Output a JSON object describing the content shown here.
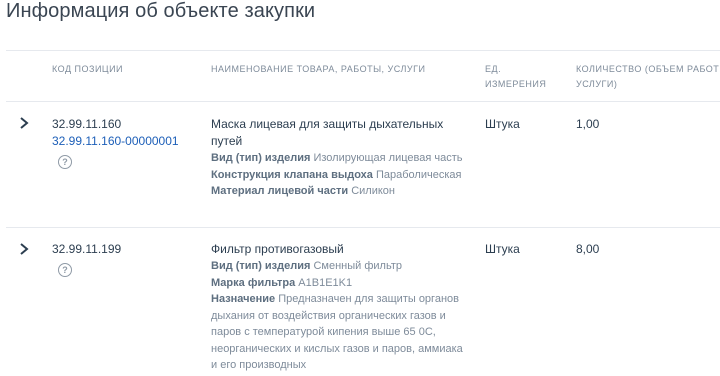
{
  "title": "Информация об объекте закупки",
  "columns": {
    "code": "КОД ПОЗИЦИИ",
    "name": "НАИМЕНОВАНИЕ ТОВАРА, РАБОТЫ, УСЛУГИ",
    "unit_line1": "ЕД.",
    "unit_line2": "ИЗМЕРЕНИЯ",
    "qty_line1": "КОЛИЧЕСТВО (ОБЪЕМ РАБОТЫ,",
    "qty_line2": "УСЛУГИ)"
  },
  "rows": [
    {
      "code": "32.99.11.160",
      "code_link": "32.99.11.160-00000001",
      "help_icon": "question-circle-icon",
      "name_line1": "Маска лицевая для защиты дыхательных",
      "name_line2": "путей",
      "attrs": [
        {
          "label": "Вид (тип) изделия",
          "value": "Изолирующая лицевая часть"
        },
        {
          "label": "Конструкция клапана выдоха",
          "value": "Параболическая"
        },
        {
          "label": "Материал лицевой части",
          "value": "Силикон"
        }
      ],
      "unit": "Штука",
      "qty": "1,00"
    },
    {
      "code": "32.99.11.199",
      "help_icon": "question-circle-icon",
      "name_line1": "Фильтр противогазовый",
      "attrs": [
        {
          "label": "Вид (тип) изделия",
          "value": "Сменный фильтр"
        },
        {
          "label": "Марка фильтра",
          "value": "A1B1E1K1"
        },
        {
          "label": "Назначение",
          "value": "Предназначен для защиты органов"
        }
      ],
      "desc_cont": [
        "дыхания от воздействия органических газов и",
        "паров с температурой кипения выше 65 0С,",
        "неорганических и кислых газов и паров, аммиака",
        "и его производных"
      ],
      "unit": "Штука",
      "qty": "8,00"
    }
  ]
}
